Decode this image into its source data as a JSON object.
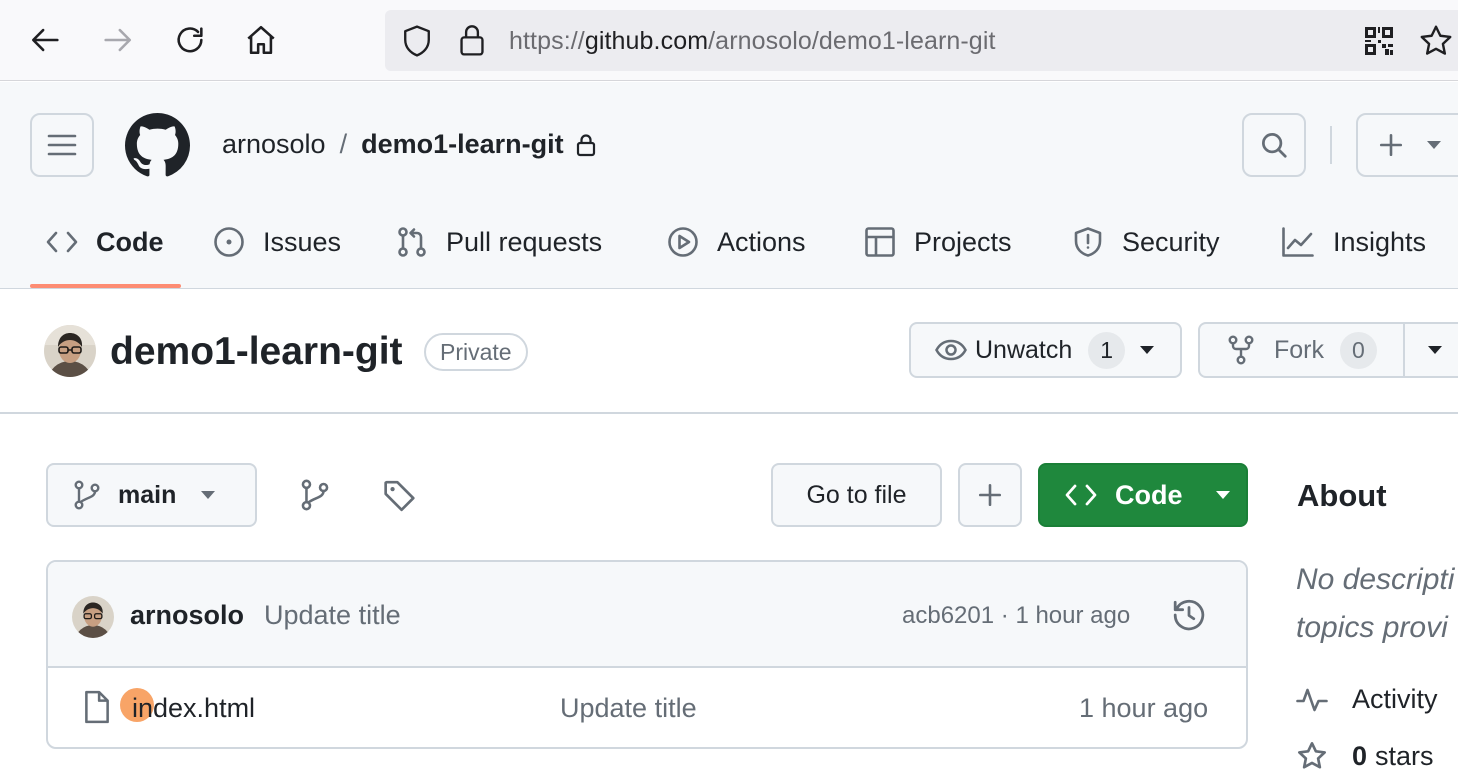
{
  "browser": {
    "url_scheme": "https://",
    "url_host": "github.com",
    "url_path": "/arnosolo/demo1-learn-git"
  },
  "header": {
    "owner": "arnosolo",
    "separator": "/",
    "repo": "demo1-learn-git"
  },
  "tabs": [
    {
      "label": "Code",
      "icon": "code-icon",
      "active": true
    },
    {
      "label": "Issues",
      "icon": "issue-icon"
    },
    {
      "label": "Pull requests",
      "icon": "pull-request-icon"
    },
    {
      "label": "Actions",
      "icon": "play-icon"
    },
    {
      "label": "Projects",
      "icon": "table-icon"
    },
    {
      "label": "Security",
      "icon": "shield-icon"
    },
    {
      "label": "Insights",
      "icon": "graph-icon"
    }
  ],
  "repo": {
    "name": "demo1-learn-git",
    "visibility": "Private",
    "unwatch_label": "Unwatch",
    "watch_count": "1",
    "fork_label": "Fork",
    "fork_count": "0"
  },
  "toolbar": {
    "branch": "main",
    "go_to_file": "Go to file",
    "code_label": "Code"
  },
  "latest_commit": {
    "author": "arnosolo",
    "message": "Update title",
    "sha": "acb6201",
    "dot": "·",
    "time": "1 hour ago"
  },
  "files": [
    {
      "name": "index.html",
      "message": "Update title",
      "time": "1 hour ago"
    }
  ],
  "about": {
    "title": "About",
    "desc_line1": "No descripti",
    "desc_line2": "topics provi",
    "activity": "Activity",
    "stars_count": "0",
    "stars_label": "stars"
  },
  "colors": {
    "accent_underline": "#fd8c73",
    "primary_button": "#1f883d",
    "cursor_highlight": "#f79a57"
  }
}
